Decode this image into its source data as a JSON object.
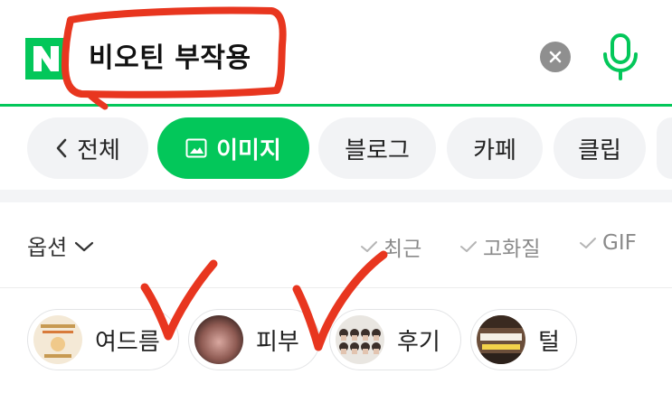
{
  "search": {
    "logo_letter": "N",
    "query": "비오틴 부작용",
    "brand_color": "#03c75a"
  },
  "tabs": [
    {
      "label": "전체",
      "icon": "chevron-left-icon",
      "active": false
    },
    {
      "label": "이미지",
      "icon": "image-icon",
      "active": true
    },
    {
      "label": "블로그",
      "active": false
    },
    {
      "label": "카페",
      "active": false
    },
    {
      "label": "클립",
      "active": false
    }
  ],
  "options": {
    "toggle_label": "옵션",
    "filters": [
      {
        "label": "최근",
        "icon": "check-icon"
      },
      {
        "label": "고화질",
        "icon": "check-icon"
      },
      {
        "label": "GIF",
        "icon": "check-icon"
      }
    ]
  },
  "related": [
    {
      "label": "여드름",
      "thumb": "acne-thumbnail"
    },
    {
      "label": "피부",
      "thumb": "skin-thumbnail"
    },
    {
      "label": "후기",
      "thumb": "review-thumbnail"
    },
    {
      "label": "털",
      "thumb": "hair-thumbnail"
    }
  ],
  "annotation_color": "#e8361f"
}
